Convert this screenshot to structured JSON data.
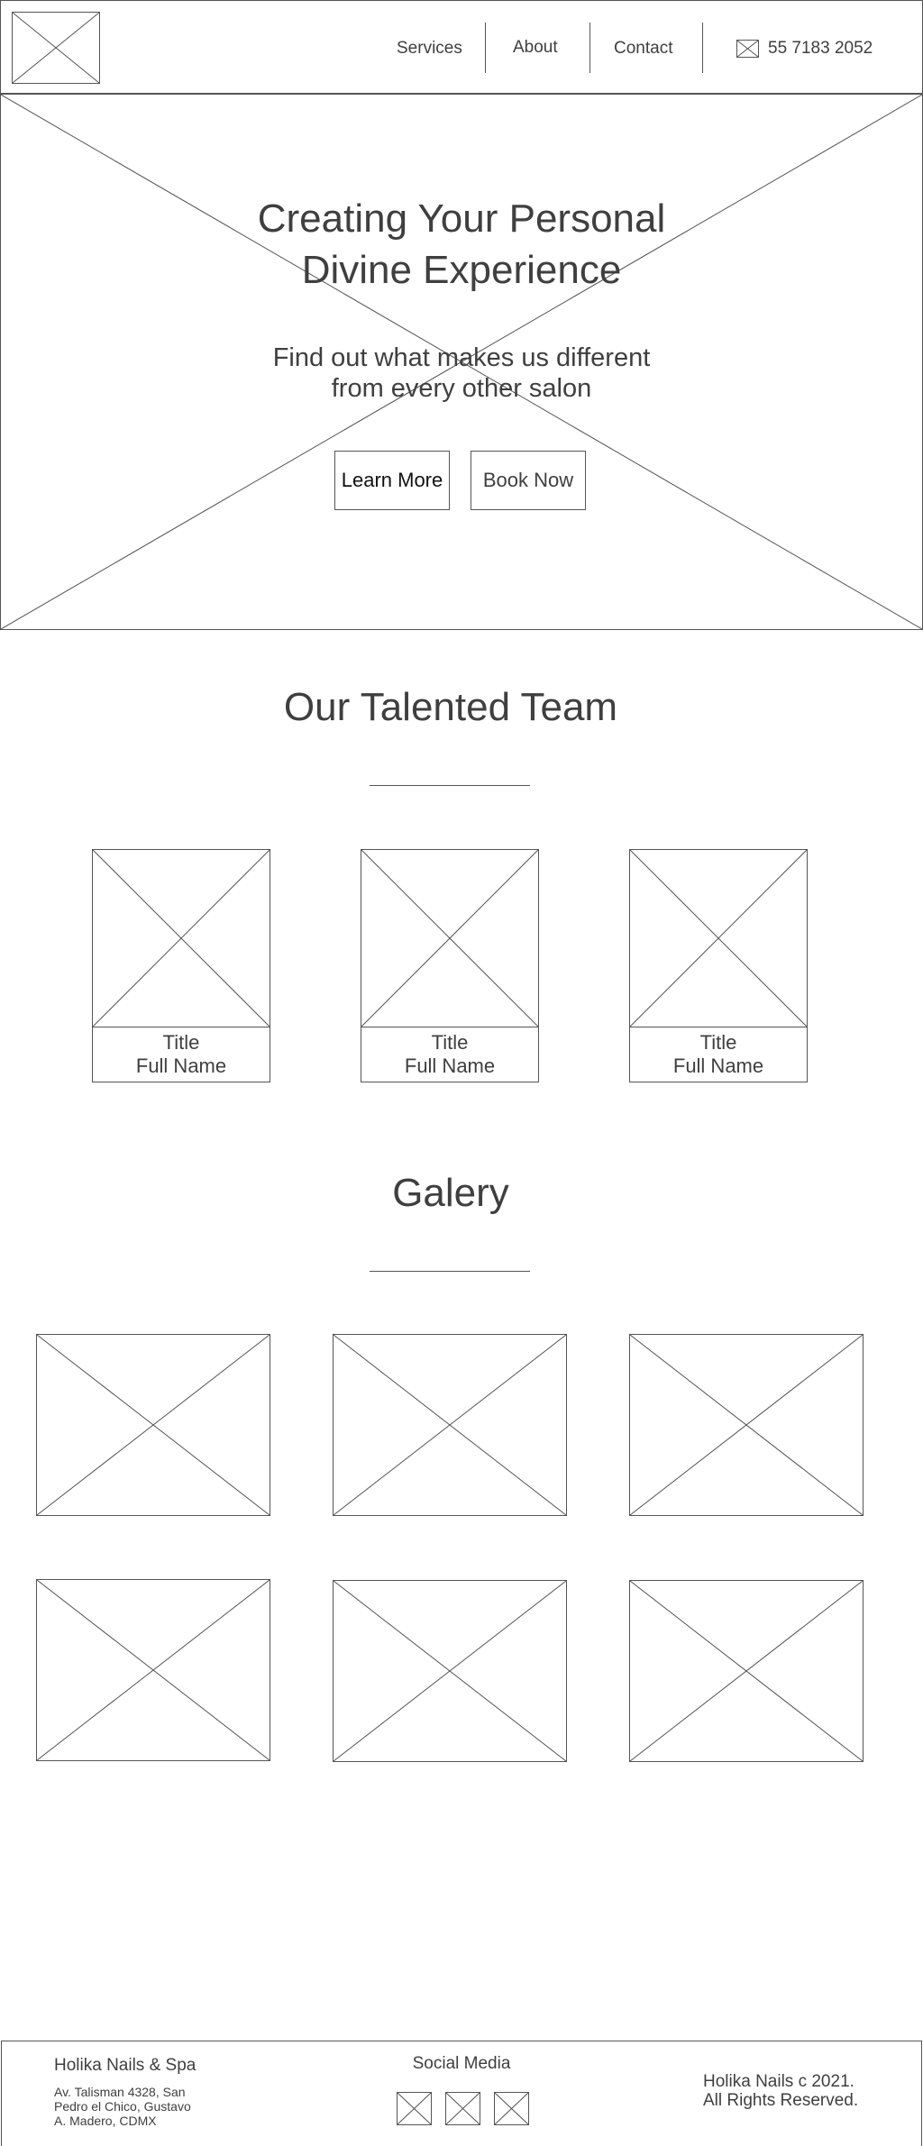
{
  "header": {
    "nav": [
      "Services",
      "About",
      "Contact"
    ],
    "phone": "55 7183 2052",
    "phone_icon": "phone-icon"
  },
  "hero": {
    "title_line1": "Creating Your Personal",
    "title_line2": "Divine Experience",
    "subtitle_line1": "Find out what makes us different",
    "subtitle_line2": "from every other salon",
    "learn_more": "Learn More",
    "book_now": "Book Now"
  },
  "team": {
    "title": "Our Talented Team",
    "members": [
      {
        "title": "Title",
        "name": "Full Name"
      },
      {
        "title": "Title",
        "name": "Full Name"
      },
      {
        "title": "Title",
        "name": "Full Name"
      }
    ]
  },
  "gallery": {
    "title": "Galery"
  },
  "footer": {
    "brand": "Holika Nails & Spa",
    "address_line1": "Av. Talisman 4328, San",
    "address_line2": "Pedro el Chico, Gustavo",
    "address_line3": "A. Madero, CDMX",
    "social_title": "Social Media",
    "copyright_line1": "Holika Nails c 2021.",
    "copyright_line2": "All Rights Reserved."
  },
  "colors": {
    "line": "#555555",
    "text": "#3f3f3f",
    "background": "#ffffff"
  }
}
